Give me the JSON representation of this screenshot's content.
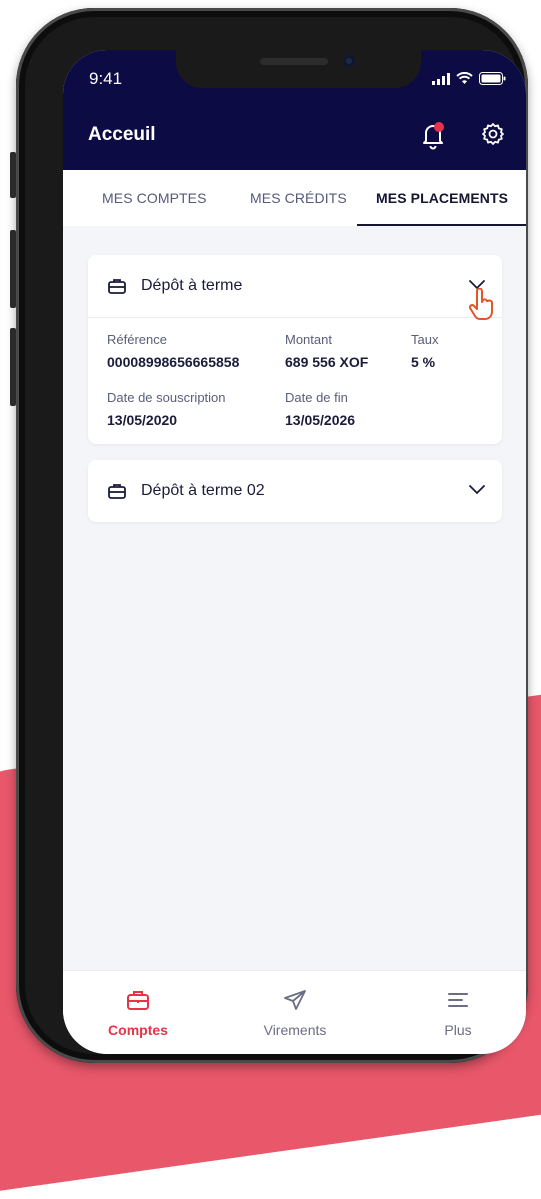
{
  "status": {
    "time": "9:41"
  },
  "header": {
    "title": "Acceuil"
  },
  "tabs": [
    {
      "label": "MES COMPTES",
      "active": false
    },
    {
      "label": "MES CRÉDITS",
      "active": false
    },
    {
      "label": "MES PLACEMENTS",
      "active": true
    }
  ],
  "placements": [
    {
      "title": "Dépôt à terme",
      "expanded": true,
      "reference_label": "Référence",
      "reference": "00008998656665858",
      "montant_label": "Montant",
      "montant": "689 556 XOF",
      "taux_label": "Taux",
      "taux": "5 %",
      "souscription_label": "Date de souscription",
      "souscription": "13/05/2020",
      "fin_label": "Date de fin",
      "fin": "13/05/2026"
    },
    {
      "title": "Dépôt à terme 02",
      "expanded": false
    }
  ],
  "tabbar": [
    {
      "label": "Comptes",
      "icon": "briefcase-icon",
      "active": true
    },
    {
      "label": "Virements",
      "icon": "paper-plane-icon",
      "active": false
    },
    {
      "label": "Plus",
      "icon": "menu-icon",
      "active": false
    }
  ],
  "colors": {
    "header": "#0c0b44",
    "accent": "#e5344a",
    "pointer": "#e2562a",
    "background_blob": "#e8576a",
    "screen_bg": "#f4f5f8"
  }
}
